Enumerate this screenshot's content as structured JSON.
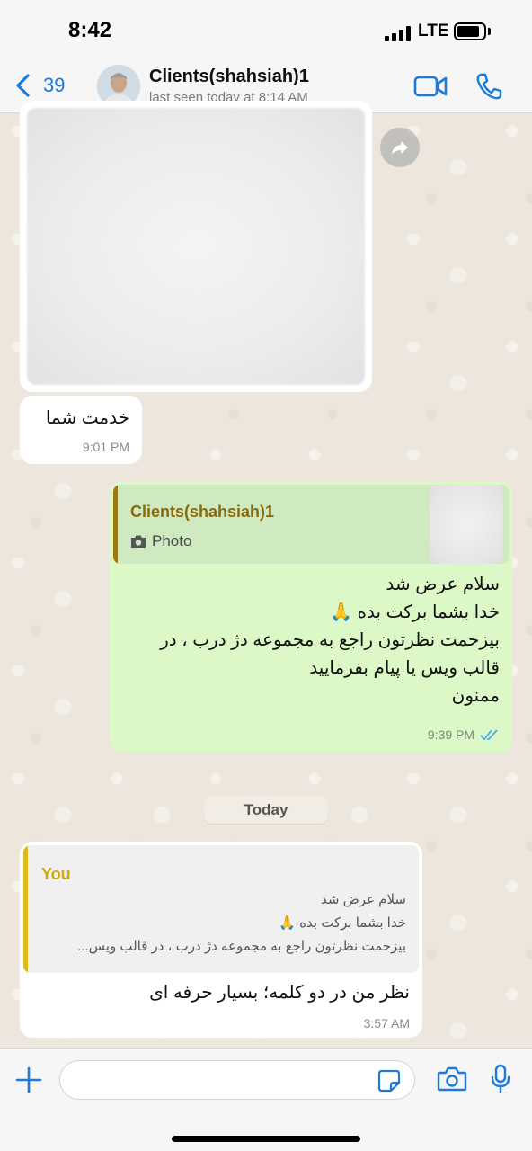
{
  "status_bar": {
    "time": "8:42",
    "network": "LTE",
    "signal_bars": 4,
    "battery_level": 0.85
  },
  "header": {
    "back_count": "39",
    "contact_name": "Clients(shahsiah)1",
    "last_seen": "last seen today at 8:14 AM",
    "icons": [
      "chevron-left-icon",
      "video-call-icon",
      "phone-icon"
    ]
  },
  "messages": {
    "incoming_text": {
      "text": "خدمت شما",
      "time": "9:01 PM"
    },
    "outgoing": {
      "quote_name": "Clients(shahsiah)1",
      "quote_type": "Photo",
      "lines": [
        "سلام عرض شد",
        "خدا بشما برکت بده 🙏",
        "بیزحمت نظرتون راجع به مجموعه دژ درب ، در",
        "قالب ویس یا پیام بفرمایید",
        "ممنون"
      ],
      "time": "9:39 PM"
    },
    "day_separator": "Today",
    "reply": {
      "quote_name": "You",
      "quote_lines": [
        "سلام عرض شد",
        "خدا بشما برکت بده 🙏",
        "بیزحمت نظرتون راجع به مجموعه دژ درب ، در قالب ویس..."
      ],
      "text": "نظر من در دو کلمه؛ بسیار حرفه ای",
      "time": "3:57 AM"
    }
  },
  "colors": {
    "accent": "#1a7bdc",
    "outgoing_bubble": "#dcf8c6",
    "incoming_bubble": "#ffffff",
    "read_ticks": "#4fa8e8",
    "quote_you": "#d1a90c"
  },
  "input": {
    "placeholder": ""
  }
}
